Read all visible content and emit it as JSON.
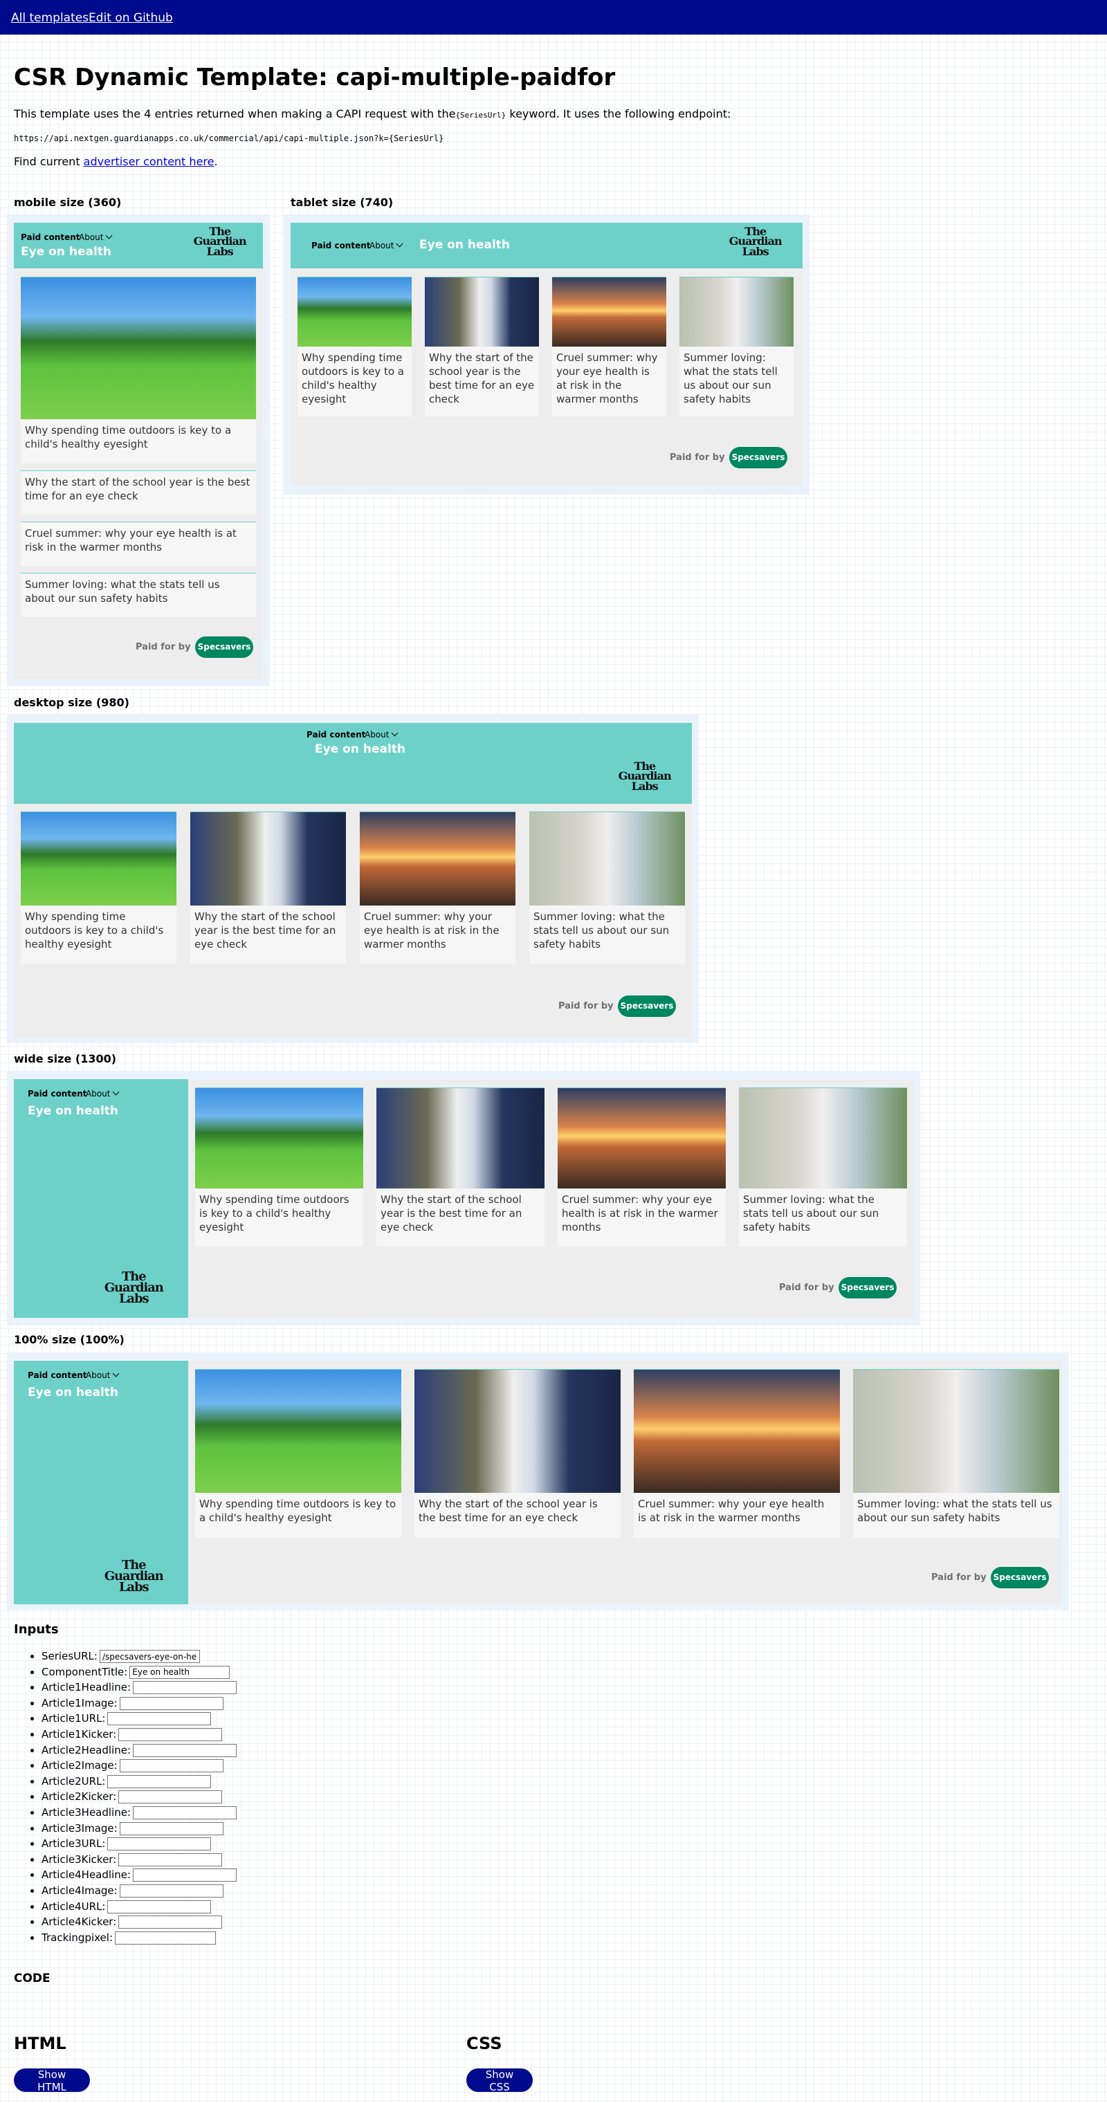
{
  "nav": {
    "all_templates": "All templates",
    "edit_github": "Edit on Github"
  },
  "page": {
    "title": "CSR Dynamic Template: capi-multiple-paidfor",
    "intro_before": "This template uses the 4 entries returned when making a CAPI request with the",
    "intro_code": "{SeriesUrl}",
    "intro_after": " keyword. It uses the following endpoint:",
    "endpoint": "https://api.nextgen.guardianapps.co.uk/commercial/api/capi-multiple.json?k={SeriesUrl}",
    "find_before": "Find current ",
    "find_link": "advertiser content here",
    "find_after": "."
  },
  "sizes": {
    "mobile": "mobile size (360)",
    "tablet": "tablet size (740)",
    "desktop": "desktop size (980)",
    "wide": "wide size (1300)",
    "full": "100% size (100%)"
  },
  "component": {
    "paid_content": "Paid content",
    "about": "About",
    "title": "Eye on health",
    "logo_line1": "The",
    "logo_line2": "Guardian",
    "logo_line3": "Labs",
    "paid_for_by": "Paid for by",
    "sponsor": "Specsavers",
    "articles": [
      {
        "headline": "Why spending time outdoors is key to a child's healthy eyesight"
      },
      {
        "headline": "Why the start of the school year is the best time for an eye check"
      },
      {
        "headline": "Cruel summer: why your eye health is at risk in the warmer months"
      },
      {
        "headline": "Summer loving: what the stats tell us about our sun safety habits"
      }
    ]
  },
  "inputs": {
    "heading": "Inputs",
    "fields": [
      {
        "label": "SeriesURL:",
        "value": "/specsavers-eye-on-health"
      },
      {
        "label": "ComponentTitle:",
        "value": "Eye on health"
      },
      {
        "label": "Article1Headline:",
        "value": ""
      },
      {
        "label": "Article1Image:",
        "value": ""
      },
      {
        "label": "Article1URL:",
        "value": ""
      },
      {
        "label": "Article1Kicker:",
        "value": ""
      },
      {
        "label": "Article2Headline:",
        "value": ""
      },
      {
        "label": "Article2Image:",
        "value": ""
      },
      {
        "label": "Article2URL:",
        "value": ""
      },
      {
        "label": "Article2Kicker:",
        "value": ""
      },
      {
        "label": "Article3Headline:",
        "value": ""
      },
      {
        "label": "Article3Image:",
        "value": ""
      },
      {
        "label": "Article3URL:",
        "value": ""
      },
      {
        "label": "Article3Kicker:",
        "value": ""
      },
      {
        "label": "Article4Headline:",
        "value": ""
      },
      {
        "label": "Article4Image:",
        "value": ""
      },
      {
        "label": "Article4URL:",
        "value": ""
      },
      {
        "label": "Article4Kicker:",
        "value": ""
      },
      {
        "label": "Trackingpixel:",
        "value": ""
      }
    ]
  },
  "code": {
    "heading": "CODE",
    "html_heading": "HTML",
    "css_heading": "CSS",
    "show_html": "Show HTML",
    "show_css": "Show CSS"
  },
  "colors": {
    "topbar": "#000a8c",
    "header_teal": "#6ed1c9",
    "sponsor_green": "#00875f",
    "component_bg": "#ededed"
  }
}
